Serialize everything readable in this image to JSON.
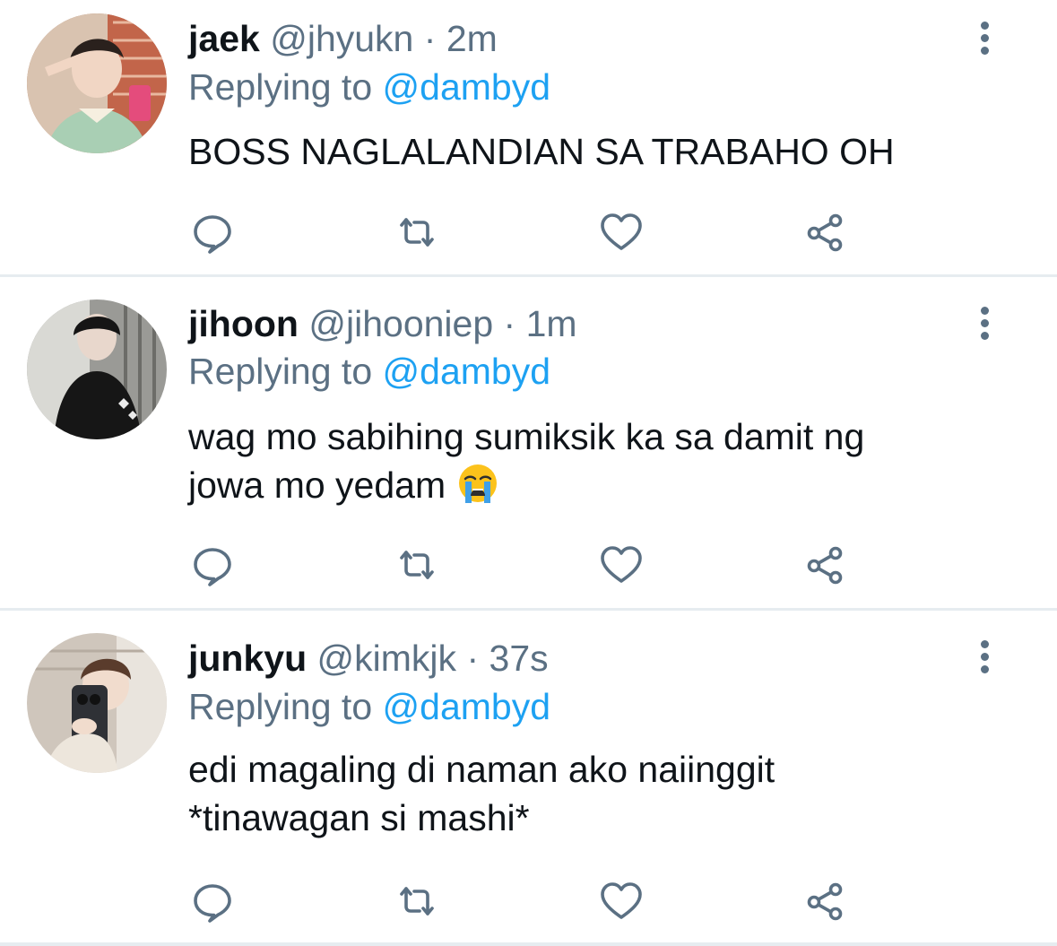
{
  "colors": {
    "primary_text": "#0f1419",
    "secondary_text": "#5b7083",
    "link": "#1da1f2",
    "divider": "#e6ecf0"
  },
  "tweets": [
    {
      "name": "jaek",
      "handle": "@jhyukn",
      "separator": "·",
      "time": "2m",
      "replying_prefix": "Replying to",
      "replying_to": "@dambyd",
      "text": "BOSS NAGLALANDIAN SA TRABAHO OH"
    },
    {
      "name": "jihoon",
      "handle": "@jihooniep",
      "separator": "·",
      "time": "1m",
      "replying_prefix": "Replying to",
      "replying_to": "@dambyd",
      "text_line1": "wag mo sabihing sumiksik ka sa damit ng",
      "text_line2": "jowa mo yedam",
      "emoji": "loudly-crying-face"
    },
    {
      "name": "junkyu",
      "handle": "@kimkjk",
      "separator": "·",
      "time": "37s",
      "replying_prefix": "Replying to",
      "replying_to": "@dambyd",
      "text_line1": "edi magaling di naman ako naiinggit",
      "text_line2": "*tinawagan si mashi*"
    }
  ],
  "icons": {
    "reply": "comment-icon",
    "retweet": "retweet-icon",
    "like": "heart-icon",
    "share": "share-icon",
    "more": "more-vertical-icon"
  }
}
